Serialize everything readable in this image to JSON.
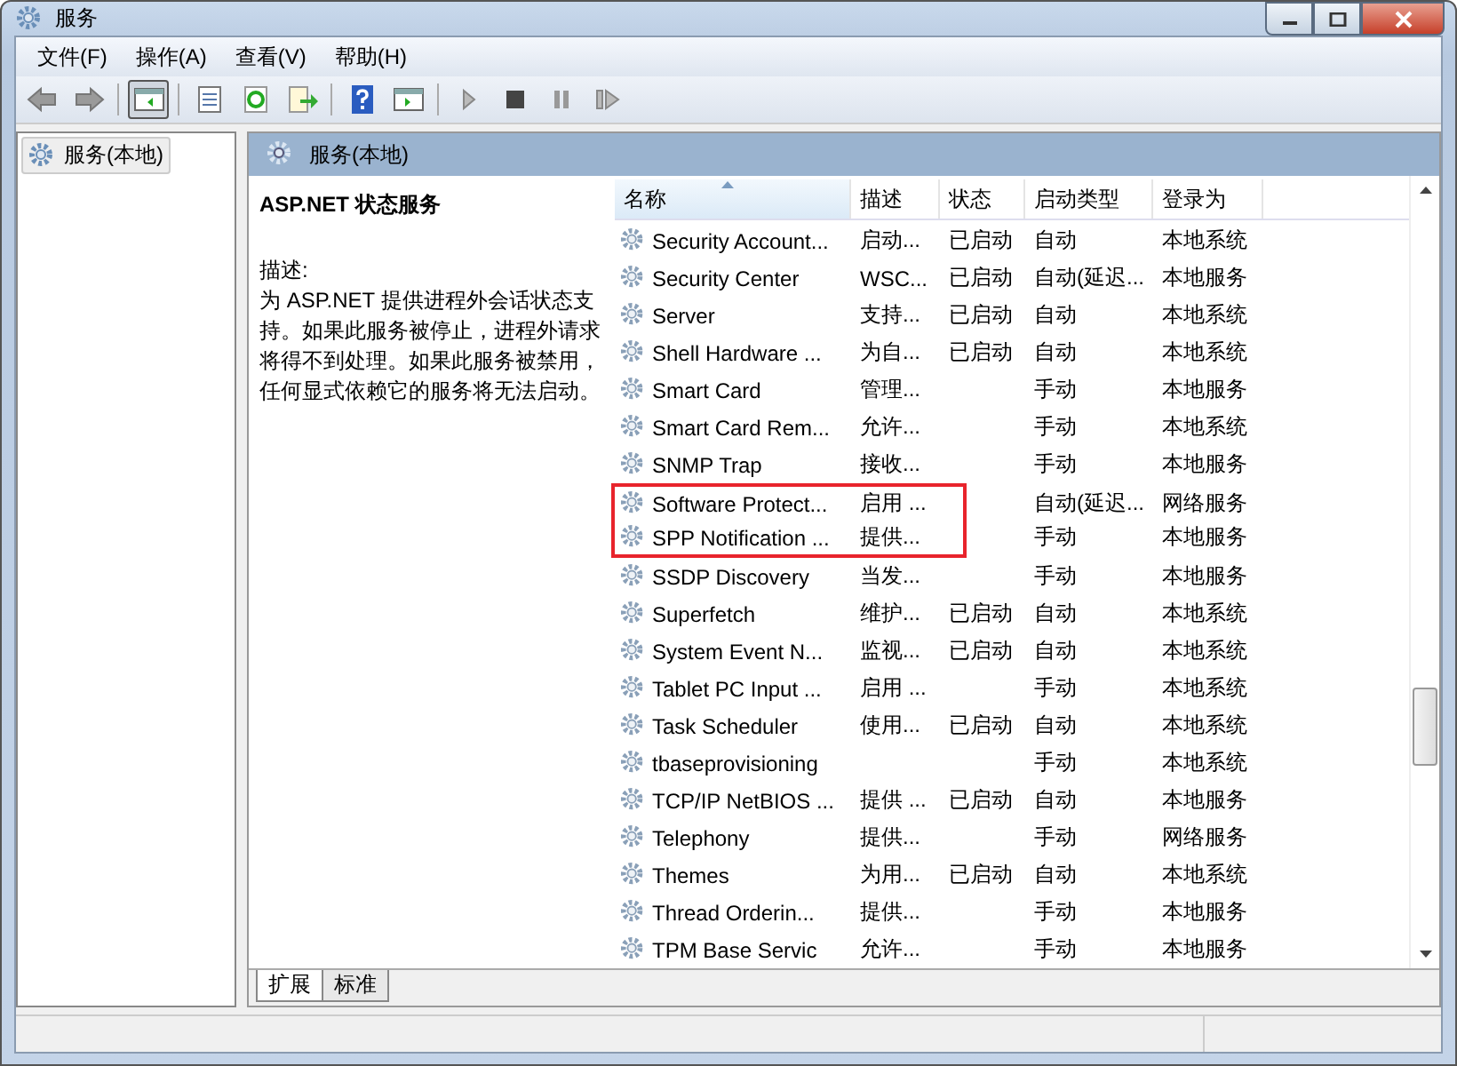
{
  "window": {
    "title": "服务"
  },
  "menu": [
    "文件(F)",
    "操作(A)",
    "查看(V)",
    "帮助(H)"
  ],
  "toolbar": [
    [
      {
        "kind": "back",
        "selected": false
      },
      {
        "kind": "forward",
        "selected": false
      }
    ],
    [
      {
        "kind": "tree",
        "selected": true
      }
    ],
    [
      {
        "kind": "props",
        "selected": false
      },
      {
        "kind": "refresh",
        "selected": false
      },
      {
        "kind": "export",
        "selected": false
      }
    ],
    [
      {
        "kind": "help",
        "selected": false
      },
      {
        "kind": "pane",
        "selected": false
      }
    ],
    [
      {
        "kind": "play",
        "selected": false
      },
      {
        "kind": "stop",
        "selected": false
      },
      {
        "kind": "pause",
        "selected": false
      },
      {
        "kind": "resume",
        "selected": false
      }
    ]
  ],
  "tree": [
    {
      "label": "服务(本地)",
      "selected": true
    }
  ],
  "pane_header": "服务(本地)",
  "description": {
    "title": "ASP.NET 状态服务",
    "label": "描述:",
    "text": "为 ASP.NET 提供进程外会话状态支持。如果此服务被停止，进程外请求将得不到处理。如果此服务被禁用，任何显式依赖它的服务将无法启动。"
  },
  "table": {
    "columns": [
      "名称",
      "描述",
      "状态",
      "启动类型",
      "登录为"
    ],
    "rows": [
      {
        "name": "Security Account...",
        "desc": "启动...",
        "status": "已启动",
        "startup": "自动",
        "logon": "本地系统",
        "highlighted": false
      },
      {
        "name": "Security Center",
        "desc": "WSC...",
        "status": "已启动",
        "startup": "自动(延迟...",
        "logon": "本地服务",
        "highlighted": false
      },
      {
        "name": "Server",
        "desc": "支持...",
        "status": "已启动",
        "startup": "自动",
        "logon": "本地系统",
        "highlighted": false
      },
      {
        "name": "Shell Hardware ...",
        "desc": "为自...",
        "status": "已启动",
        "startup": "自动",
        "logon": "本地系统",
        "highlighted": false
      },
      {
        "name": "Smart Card",
        "desc": "管理...",
        "status": "",
        "startup": "手动",
        "logon": "本地服务",
        "highlighted": false
      },
      {
        "name": "Smart Card Rem...",
        "desc": "允许...",
        "status": "",
        "startup": "手动",
        "logon": "本地系统",
        "highlighted": false
      },
      {
        "name": "SNMP Trap",
        "desc": "接收...",
        "status": "",
        "startup": "手动",
        "logon": "本地服务",
        "highlighted": false
      },
      {
        "name": "Software Protect...",
        "desc": "启用 ...",
        "status": "",
        "startup": "自动(延迟...",
        "logon": "网络服务",
        "highlighted": true
      },
      {
        "name": "SPP Notification ...",
        "desc": "提供...",
        "status": "",
        "startup": "手动",
        "logon": "本地服务",
        "highlighted": true
      },
      {
        "name": "SSDP Discovery",
        "desc": "当发...",
        "status": "",
        "startup": "手动",
        "logon": "本地服务",
        "highlighted": false
      },
      {
        "name": "Superfetch",
        "desc": "维护...",
        "status": "已启动",
        "startup": "自动",
        "logon": "本地系统",
        "highlighted": false
      },
      {
        "name": "System Event N...",
        "desc": "监视...",
        "status": "已启动",
        "startup": "自动",
        "logon": "本地系统",
        "highlighted": false
      },
      {
        "name": "Tablet PC Input ...",
        "desc": "启用 ...",
        "status": "",
        "startup": "手动",
        "logon": "本地系统",
        "highlighted": false
      },
      {
        "name": "Task Scheduler",
        "desc": "使用...",
        "status": "已启动",
        "startup": "自动",
        "logon": "本地系统",
        "highlighted": false
      },
      {
        "name": "tbaseprovisioning",
        "desc": "",
        "status": "",
        "startup": "手动",
        "logon": "本地系统",
        "highlighted": false
      },
      {
        "name": "TCP/IP NetBIOS ...",
        "desc": "提供 ...",
        "status": "已启动",
        "startup": "自动",
        "logon": "本地服务",
        "highlighted": false
      },
      {
        "name": "Telephony",
        "desc": "提供...",
        "status": "",
        "startup": "手动",
        "logon": "网络服务",
        "highlighted": false
      },
      {
        "name": "Themes",
        "desc": "为用...",
        "status": "已启动",
        "startup": "自动",
        "logon": "本地系统",
        "highlighted": false
      },
      {
        "name": "Thread Orderin...",
        "desc": "提供...",
        "status": "",
        "startup": "手动",
        "logon": "本地服务",
        "highlighted": false
      },
      {
        "name": "TPM Base Servic",
        "desc": "允许...",
        "status": "",
        "startup": "手动",
        "logon": "本地服务",
        "highlighted": false
      }
    ]
  },
  "tabs": [
    {
      "label": "扩展",
      "selected": true
    },
    {
      "label": "标准",
      "selected": false
    }
  ]
}
